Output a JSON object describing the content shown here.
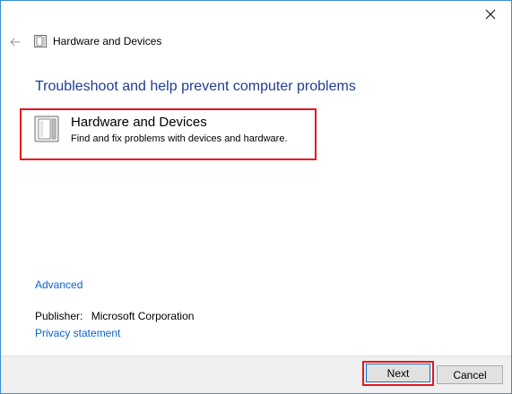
{
  "window": {
    "title": "Hardware and Devices",
    "close_icon": "close-icon",
    "back_icon": "back-arrow-icon"
  },
  "content": {
    "heading": "Troubleshoot and help prevent computer problems",
    "troubleshooter": {
      "title": "Hardware and Devices",
      "description": "Find and fix problems with devices and hardware.",
      "icon": "hardware-device-icon"
    },
    "advanced_link": "Advanced",
    "publisher_label": "Publisher:",
    "publisher_value": "Microsoft Corporation",
    "privacy_link": "Privacy statement"
  },
  "footer": {
    "next_label": "Next",
    "cancel_label": "Cancel"
  },
  "colors": {
    "heading": "#1e3d8f",
    "link": "#0a63c9",
    "highlight": "#e8141c",
    "window_border": "#3a8fd6"
  }
}
